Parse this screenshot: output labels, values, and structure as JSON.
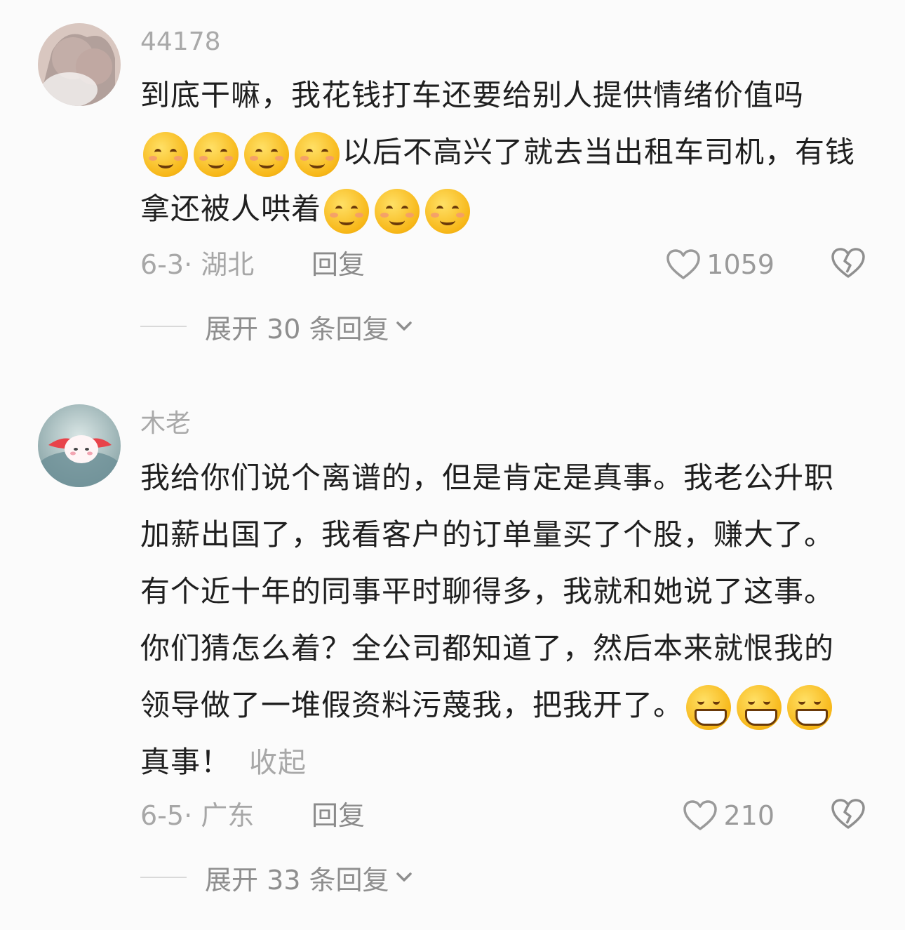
{
  "comments": [
    {
      "username": "44178",
      "text_parts": {
        "a": "到底干嘛，我花钱打车还要给别人提供情绪价值吗",
        "b": "以后不高兴了就去当出租车司机，有钱拿还被人哄着"
      },
      "emoji_groups": [
        {
          "icon": "smiling-face-emoji",
          "count": 4
        },
        {
          "icon": "smiling-face-emoji",
          "count": 3
        }
      ],
      "date_location": "6-3· 湖北",
      "reply_label": "回复",
      "like_count": "1059",
      "expand_label": "展开 30 条回复"
    },
    {
      "username": "木老",
      "text_parts": {
        "a": "我给你们说个离谱的，但是肯定是真事。我老公升职加薪出国了，我看客户的订单量买了个股，赚大了。有个近十年的同事平时聊得多，我就和她说了这事。你们猜怎么着？全公司都知道了，然后本来就恨我的领导做了一堆假资料污蔑我，把我开了。",
        "b": "真事！"
      },
      "emoji_groups": [
        {
          "icon": "grinning-face-emoji",
          "count": 3
        }
      ],
      "collapse_label": "收起",
      "date_location": "6-5· 广东",
      "reply_label": "回复",
      "like_count": "210",
      "expand_label": "展开 33 条回复"
    }
  ],
  "colors": {
    "background": "#fbfbfb",
    "username": "#a9a9a9",
    "body_text": "#1f1f1f",
    "meta_text": "#a7a7a7"
  }
}
